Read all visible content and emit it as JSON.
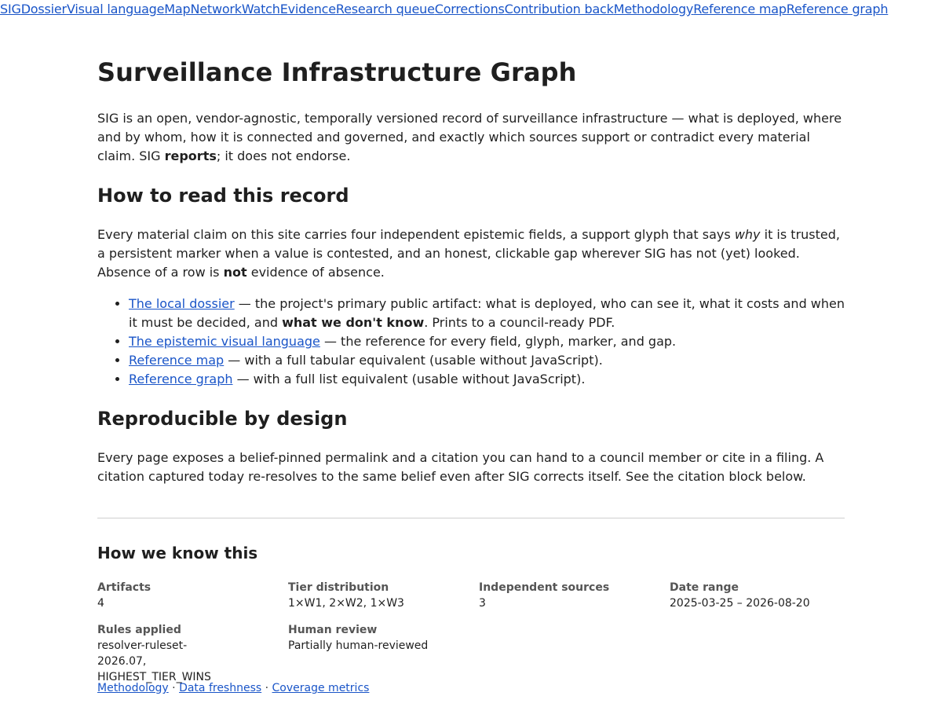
{
  "nav": {
    "items": [
      "SIG",
      "Dossier",
      "Visual language",
      "Map",
      "Network",
      "Watch",
      "Evidence",
      "Research queue",
      "Corrections",
      "Contribution back",
      "Methodology",
      "Reference map",
      "Reference graph"
    ]
  },
  "page": {
    "title": "Surveillance Infrastructure Graph",
    "intro": {
      "before": "SIG is an open, vendor-agnostic, temporally versioned record of surveillance infrastructure — what is deployed, where and by whom, how it is connected and governed, and exactly which sources support or contradict every material claim. SIG ",
      "bold": "reports",
      "after": "; it does not endorse."
    }
  },
  "how_to_read": {
    "heading": "How to read this record",
    "para": {
      "a": "Every material claim on this site carries four independent epistemic fields, a support glyph that says ",
      "italic": "why",
      "b": " it is trusted, a persistent marker when a value is contested, and an honest, clickable gap wherever SIG has not (yet) looked. Absence of a row is ",
      "bold": "not",
      "c": " evidence of absence."
    },
    "links": [
      {
        "link": "The local dossier",
        "a": " — the project's primary public artifact: what is deployed, who can see it, what it costs and when it must be decided, and ",
        "bold": "what we don't know",
        "b": ". Prints to a council-ready PDF."
      },
      {
        "link": "The epistemic visual language",
        "a": " — the reference for every field, glyph, marker, and gap."
      },
      {
        "link": "Reference map",
        "a": " — with a full tabular equivalent (usable without JavaScript)."
      },
      {
        "link": "Reference graph",
        "a": " — with a full list equivalent (usable without JavaScript)."
      }
    ]
  },
  "reproducible": {
    "heading": "Reproducible by design",
    "para": "Every page exposes a belief-pinned permalink and a citation you can hand to a council member or cite in a filing. A citation captured today re-resolves to the same belief even after SIG corrects itself. See the citation block below."
  },
  "how_we_know": {
    "heading": "How we know this",
    "stats": [
      {
        "label": "Artifacts",
        "value": "4"
      },
      {
        "label": "Tier distribution",
        "value": "1×W1, 2×W2, 1×W3"
      },
      {
        "label": "Independent sources",
        "value": "3"
      },
      {
        "label": "Date range",
        "value": "2025-03-25 – 2026-08-20"
      },
      {
        "label": "Rules applied",
        "value": "resolver-ruleset-2026.07, HIGHEST_TIER_WINS"
      },
      {
        "label": "Human review",
        "value": "Partially human-reviewed"
      }
    ],
    "footer_links": [
      "Methodology",
      "Data freshness",
      "Coverage metrics"
    ],
    "separator": " · "
  }
}
